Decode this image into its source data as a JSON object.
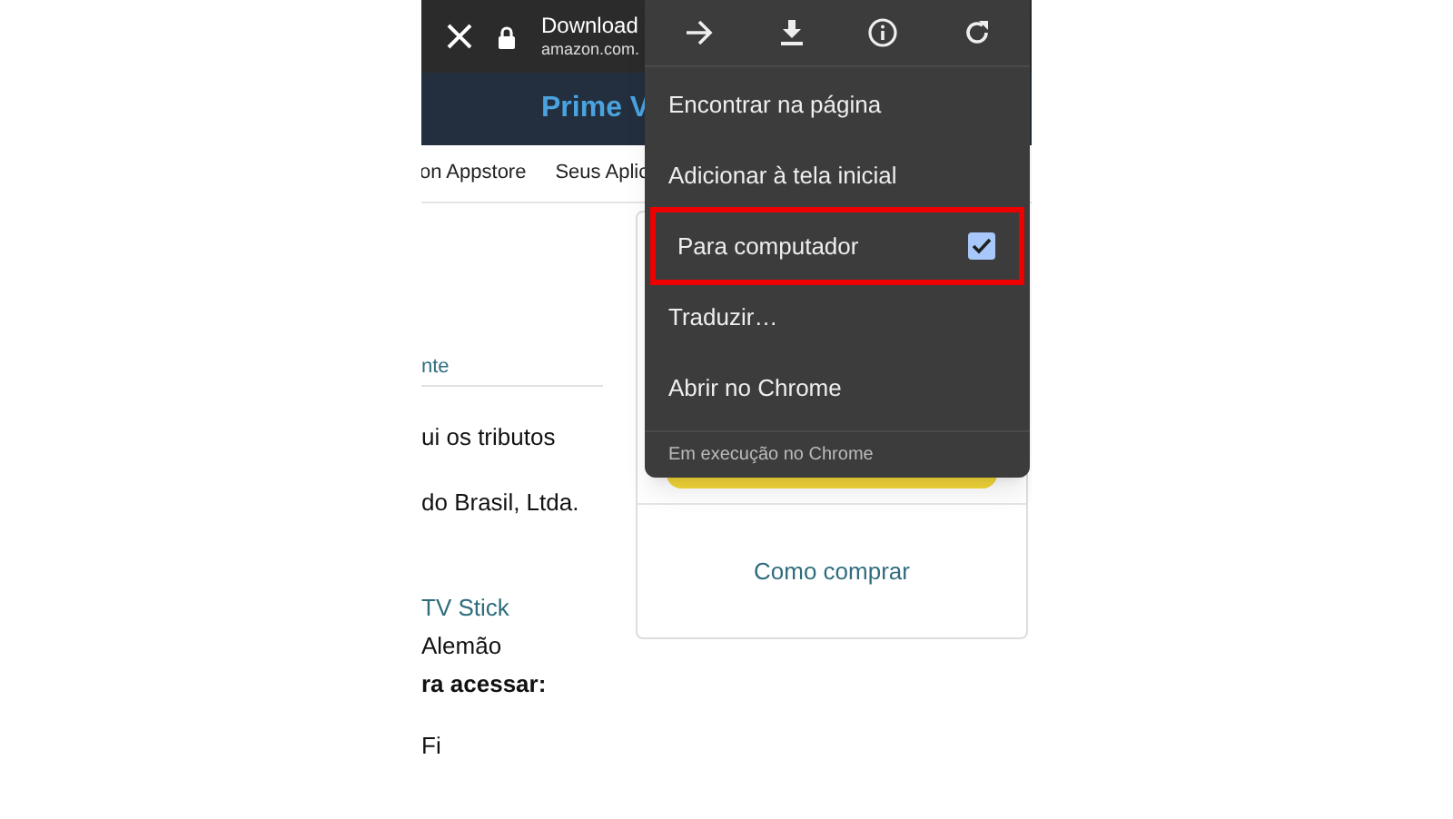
{
  "browser_bar": {
    "title": "Download",
    "url": "amazon.com."
  },
  "banner": {
    "title": "Prime V"
  },
  "nav": [
    "on Appstore",
    "Seus Aplic"
  ],
  "content": [
    {
      "kind": "link",
      "text": "nte"
    },
    {
      "kind": "text",
      "text": "ui os tributos"
    },
    {
      "kind": "text",
      "text": "do Brasil, Ltda."
    },
    {
      "kind": "link",
      "text": "TV Stick"
    },
    {
      "kind": "text",
      "text": "Alemão"
    },
    {
      "kind": "bold",
      "text": "ra acessar:"
    },
    {
      "kind": "text",
      "text": "Fi"
    }
  ],
  "card": {
    "link": "Como comprar"
  },
  "menu": {
    "items": [
      {
        "label": "Encontrar na página",
        "kind": "plain"
      },
      {
        "label": "Adicionar à tela inicial",
        "kind": "plain"
      },
      {
        "label": "Para computador",
        "kind": "checkbox",
        "checked": true,
        "highlighted": true
      },
      {
        "label": "Traduzir…",
        "kind": "plain"
      },
      {
        "label": "Abrir no Chrome",
        "kind": "plain"
      }
    ],
    "footer": "Em execução no Chrome"
  }
}
